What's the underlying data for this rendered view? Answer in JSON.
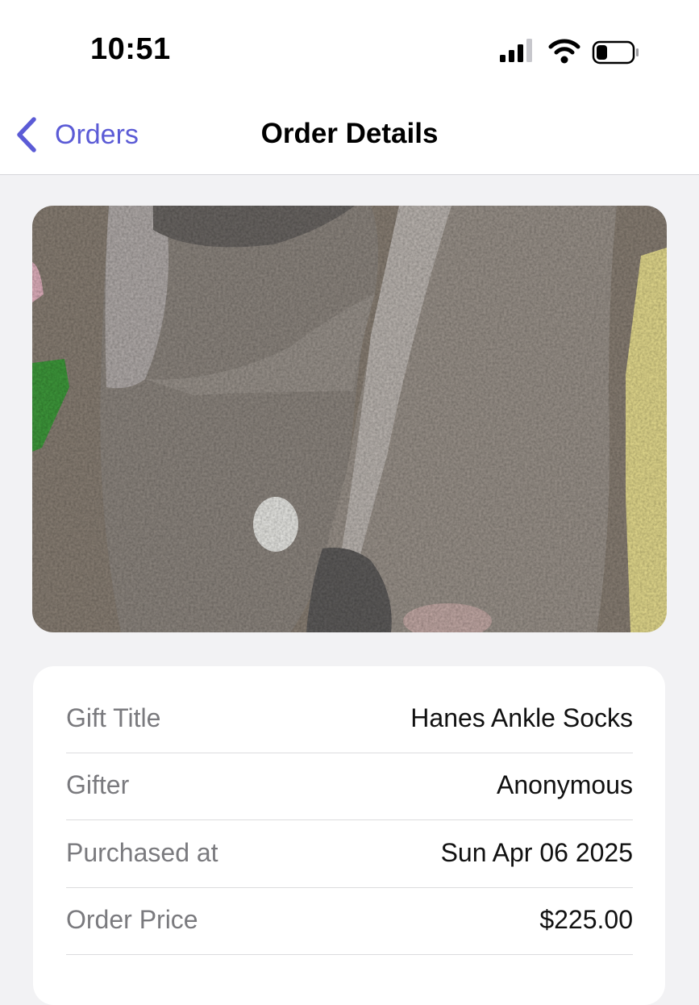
{
  "status_bar": {
    "time": "10:51",
    "icons": [
      "cellular-signal-icon",
      "wifi-icon",
      "battery-icon"
    ]
  },
  "nav": {
    "back_label": "Orders",
    "title": "Order Details",
    "accent_color": "#5b5bd6"
  },
  "product_image": {
    "description_icon": "product-photo"
  },
  "details": [
    {
      "label": "Gift Title",
      "value": "Hanes Ankle Socks"
    },
    {
      "label": "Gifter",
      "value": "Anonymous"
    },
    {
      "label": "Purchased at",
      "value": "Sun Apr 06 2025"
    },
    {
      "label": "Order Price",
      "value": "$225.00"
    }
  ]
}
